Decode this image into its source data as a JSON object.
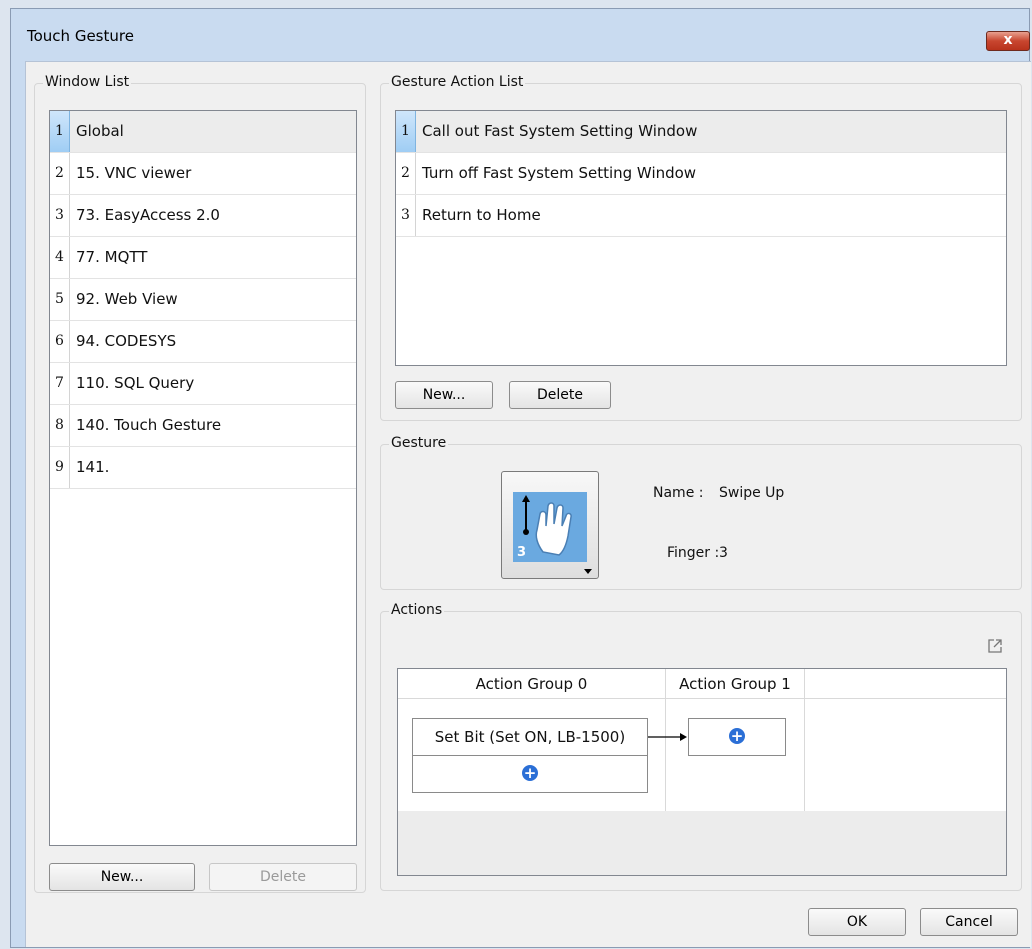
{
  "window": {
    "title": "Touch Gesture",
    "close_label": "x"
  },
  "window_list": {
    "label": "Window List",
    "items": [
      {
        "num": "1",
        "text": "Global"
      },
      {
        "num": "2",
        "text": "15. VNC viewer"
      },
      {
        "num": "3",
        "text": "73. EasyAccess 2.0"
      },
      {
        "num": "4",
        "text": "77. MQTT"
      },
      {
        "num": "5",
        "text": "92. Web View"
      },
      {
        "num": "6",
        "text": "94. CODESYS"
      },
      {
        "num": "7",
        "text": "110. SQL Query"
      },
      {
        "num": "8",
        "text": "140. Touch Gesture"
      },
      {
        "num": "9",
        "text": "141."
      }
    ],
    "selected_index": 0,
    "new_label": "New...",
    "delete_label": "Delete"
  },
  "gesture_action_list": {
    "label": "Gesture Action List",
    "items": [
      {
        "num": "1",
        "text": "Call out Fast System Setting Window"
      },
      {
        "num": "2",
        "text": "Turn off Fast System Setting Window"
      },
      {
        "num": "3",
        "text": "Return to Home"
      }
    ],
    "selected_index": 0,
    "new_label": "New...",
    "delete_label": "Delete"
  },
  "gesture": {
    "label": "Gesture",
    "icon": "swipe-up-hand-icon",
    "icon_finger_count": "3",
    "name_label": "Name :",
    "name_value": "Swipe Up",
    "finger_label": "Finger :",
    "finger_value": "3"
  },
  "actions": {
    "label": "Actions",
    "groups": [
      {
        "header": "Action Group 0",
        "items": [
          "Set Bit (Set ON, LB-1500)"
        ]
      },
      {
        "header": "Action Group 1",
        "items": []
      }
    ],
    "plus_glyph": "+"
  },
  "footer": {
    "ok_label": "OK",
    "cancel_label": "Cancel"
  },
  "colors": {
    "selection": "#9fcdf4",
    "plus": "#2b6fd6",
    "close": "#c8462f"
  }
}
